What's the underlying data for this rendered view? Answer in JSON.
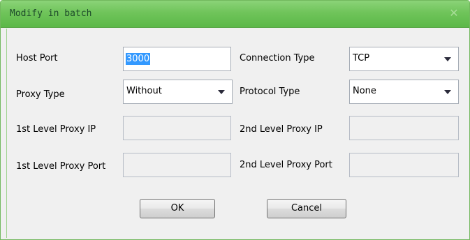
{
  "dialog": {
    "title": "Modify in batch",
    "close_symbol": "✕"
  },
  "fields": {
    "host_port": {
      "label": "Host Port",
      "value": "3000"
    },
    "connection_type": {
      "label": "Connection Type",
      "value": "TCP"
    },
    "proxy_type": {
      "label": "Proxy Type",
      "value": "Without"
    },
    "protocol_type": {
      "label": "Protocol Type",
      "value": "None"
    },
    "proxy_ip_1": {
      "label": "1st Level Proxy IP",
      "value": ""
    },
    "proxy_ip_2": {
      "label": "2nd Level Proxy IP",
      "value": ""
    },
    "proxy_port_1": {
      "label": "1st Level Proxy Port",
      "value": ""
    },
    "proxy_port_2": {
      "label": "2nd Level Proxy Port",
      "value": ""
    }
  },
  "buttons": {
    "ok": "OK",
    "cancel": "Cancel"
  },
  "icons": {
    "close": "close-icon",
    "dropdown": "chevron-down-icon"
  },
  "colors": {
    "titlebar": "#6fc45a",
    "title_text": "#1d4a2a",
    "selection": "#3399ff",
    "dialog_bg": "#f0f0f0"
  }
}
